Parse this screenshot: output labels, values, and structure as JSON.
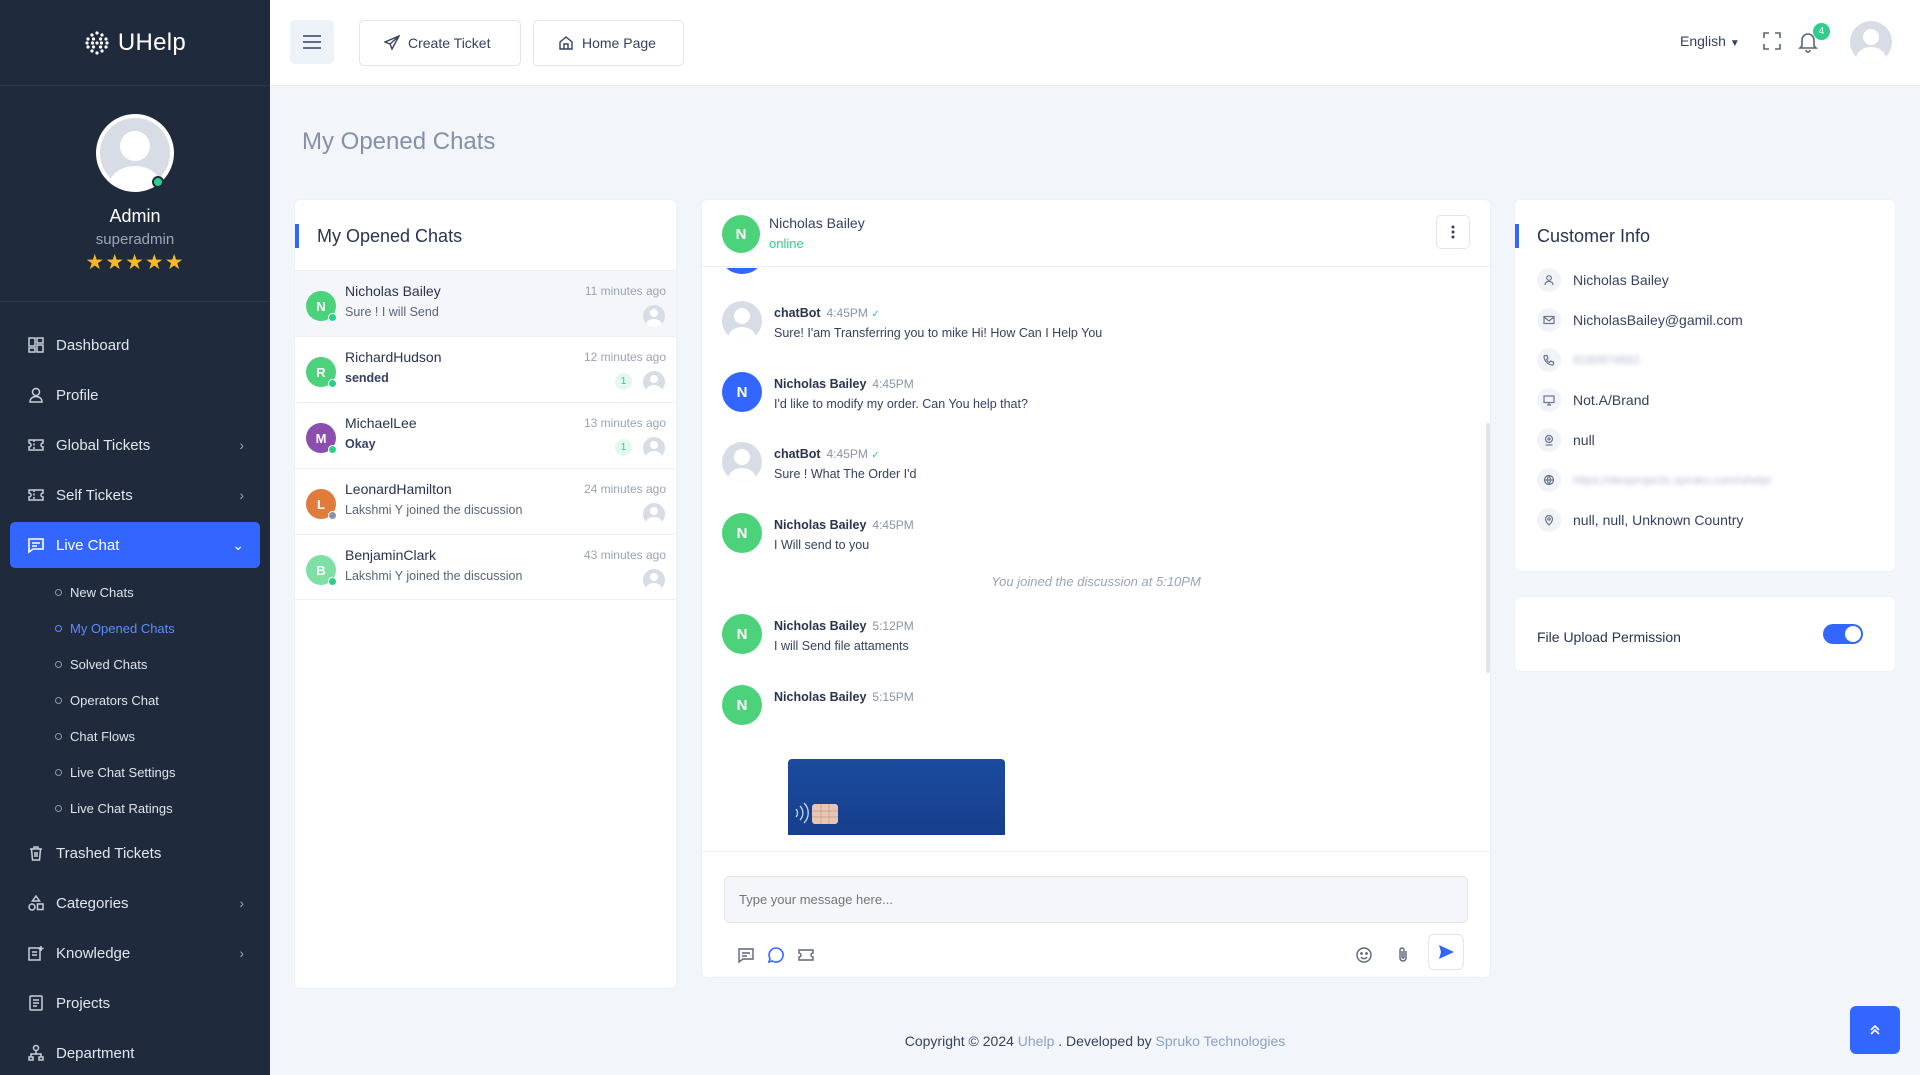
{
  "app": {
    "name": "UHelp"
  },
  "sidebar": {
    "profile": {
      "name": "Admin",
      "role": "superadmin",
      "rating": "★★★★★"
    },
    "items": [
      {
        "label": "Dashboard",
        "icon": "dashboard-icon"
      },
      {
        "label": "Profile",
        "icon": "user-icon"
      },
      {
        "label": "Global Tickets",
        "icon": "ticket-icon"
      },
      {
        "label": "Self Tickets",
        "icon": "ticket-icon"
      },
      {
        "label": "Live Chat",
        "icon": "chat-icon"
      },
      {
        "label": "Trashed Tickets",
        "icon": "trash-icon"
      },
      {
        "label": "Categories",
        "icon": "categories-icon"
      },
      {
        "label": "Knowledge",
        "icon": "knowledge-icon"
      },
      {
        "label": "Projects",
        "icon": "projects-icon"
      },
      {
        "label": "Department",
        "icon": "department-icon"
      }
    ],
    "live_chat_sub": [
      "New Chats",
      "My Opened Chats",
      "Solved Chats",
      "Operators Chat",
      "Chat Flows",
      "Live Chat Settings",
      "Live Chat Ratings"
    ]
  },
  "header": {
    "create_ticket": "Create Ticket",
    "home_page": "Home Page",
    "language": "English",
    "notification_count": "4"
  },
  "page": {
    "title": "My Opened Chats"
  },
  "chat_list": {
    "title": "My Opened Chats",
    "items": [
      {
        "initial": "N",
        "name": "Nicholas Bailey",
        "message": "Sure ! I will Send",
        "time": "11 minutes ago",
        "count": "",
        "color": "#4cd27a",
        "status_color": "#2dce89"
      },
      {
        "initial": "R",
        "name": "RichardHudson",
        "message": "sended",
        "time": "12 minutes ago",
        "count": "1",
        "color": "#4cd27a",
        "status_color": "#2dce89"
      },
      {
        "initial": "M",
        "name": "MichaelLee",
        "message": "Okay",
        "time": "13 minutes ago",
        "count": "1",
        "color": "#8a4fae",
        "status_color": "#2dce89"
      },
      {
        "initial": "L",
        "name": "LeonardHamilton",
        "message": "Lakshmi Y joined the discussion",
        "time": "24 minutes ago",
        "count": "",
        "color": "#e07b3c",
        "status_color": "#8a93a6"
      },
      {
        "initial": "B",
        "name": "BenjaminClark",
        "message": "Lakshmi Y joined the discussion",
        "time": "43 minutes ago",
        "count": "",
        "color": "#7fe0a5",
        "status_color": "#2dce89"
      }
    ]
  },
  "chat": {
    "contact_initial": "N",
    "contact_name": "Nicholas Bailey",
    "contact_status": "online",
    "messages": [
      {
        "type": "bot",
        "sender": "chatBot",
        "time": "4:45PM",
        "text": "Sure! I'am Transferring you to mike Hi! How Can I Help You"
      },
      {
        "type": "user-blue",
        "initial": "N",
        "sender": "Nicholas Bailey",
        "time": "4:45PM",
        "text": "I'd like to modify my order. Can You help that?"
      },
      {
        "type": "bot",
        "sender": "chatBot",
        "time": "4:45PM",
        "text": "Sure ! What The Order I'd"
      },
      {
        "type": "user",
        "initial": "N",
        "sender": "Nicholas Bailey",
        "time": "4:45PM",
        "text": "I Will send to you"
      },
      {
        "type": "user",
        "initial": "N",
        "sender": "Nicholas Bailey",
        "time": "5:12PM",
        "text": "I will Send file attaments"
      },
      {
        "type": "user",
        "initial": "N",
        "sender": "Nicholas Bailey",
        "time": "5:15PM",
        "text": ""
      }
    ],
    "system_message": "You joined the discussion at 5:10PM",
    "input_placeholder": "Type your message here..."
  },
  "customer": {
    "title": "Customer Info",
    "name": "Nicholas Bailey",
    "email": "NicholasBailey@gamil.com",
    "phone": "9180974682",
    "device": "Not.A/Brand",
    "ip": "null",
    "url": "https://devprojects.spruko.com/uhelp/",
    "location": "null, null, Unknown Country"
  },
  "permission": {
    "label": "File Upload Permission",
    "enabled": true
  },
  "footer": {
    "prefix": "Copyright © 2024 ",
    "brand": "Uhelp",
    "middle": " . Developed by ",
    "company": "Spruko Technologies"
  }
}
